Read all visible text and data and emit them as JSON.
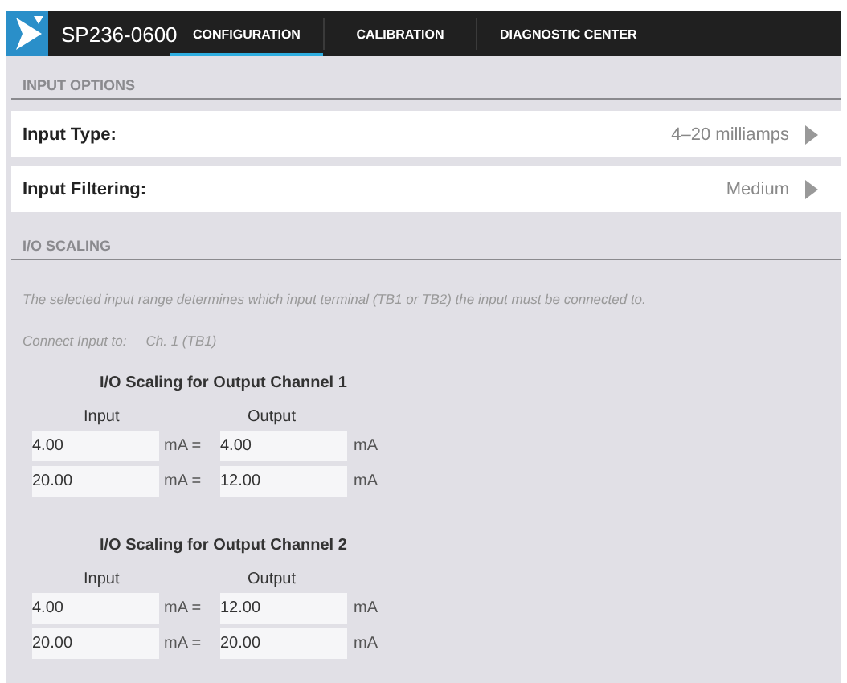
{
  "header": {
    "title": "SP236-0600",
    "tabs": [
      {
        "label": "CONFIGURATION",
        "selected": true
      },
      {
        "label": "CALIBRATION",
        "selected": false
      },
      {
        "label": "DIAGNOSTIC CENTER",
        "selected": false
      }
    ]
  },
  "input_options": {
    "heading": "INPUT OPTIONS",
    "rows": [
      {
        "label": "Input Type:",
        "value": "4–20 milliamps"
      },
      {
        "label": "Input Filtering:",
        "value": "Medium"
      }
    ]
  },
  "io_scaling": {
    "heading": "I/O SCALING",
    "note": "The selected input range determines which input terminal (TB1 or TB2) the input must be connected to.",
    "connect_label": "Connect Input to:",
    "connect_value": "Ch. 1 (TB1)",
    "channels": [
      {
        "title": "I/O Scaling for Output Channel 1",
        "input_label": "Input",
        "output_label": "Output",
        "rows": [
          {
            "input": "4.00",
            "input_unit": "mA =",
            "output": "4.00",
            "output_unit": "mA"
          },
          {
            "input": "20.00",
            "input_unit": "mA =",
            "output": "12.00",
            "output_unit": "mA"
          }
        ]
      },
      {
        "title": "I/O Scaling for Output Channel 2",
        "input_label": "Input",
        "output_label": "Output",
        "rows": [
          {
            "input": "4.00",
            "input_unit": "mA =",
            "output": "12.00",
            "output_unit": "mA"
          },
          {
            "input": "20.00",
            "input_unit": "mA =",
            "output": "20.00",
            "output_unit": "mA"
          }
        ]
      }
    ]
  }
}
